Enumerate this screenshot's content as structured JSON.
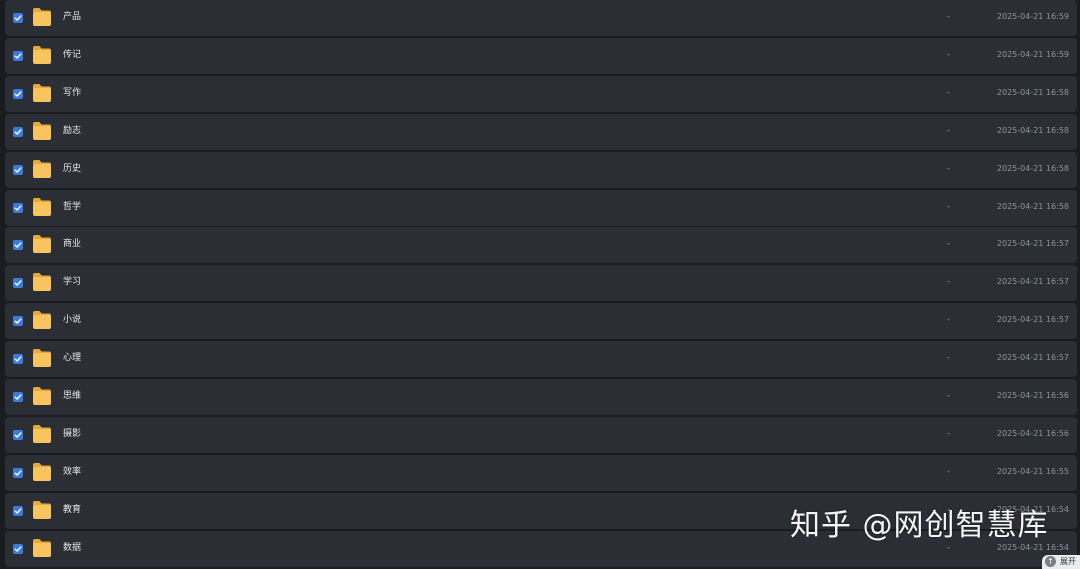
{
  "rows": [
    {
      "name": "产品",
      "size": "-",
      "date": "2025-04-21 16:59",
      "checked": true
    },
    {
      "name": "传记",
      "size": "-",
      "date": "2025-04-21 16:59",
      "checked": true
    },
    {
      "name": "写作",
      "size": "-",
      "date": "2025-04-21 16:58",
      "checked": true
    },
    {
      "name": "励志",
      "size": "-",
      "date": "2025-04-21 16:58",
      "checked": true
    },
    {
      "name": "历史",
      "size": "-",
      "date": "2025-04-21 16:58",
      "checked": true
    },
    {
      "name": "哲学",
      "size": "-",
      "date": "2025-04-21 16:58",
      "checked": true
    },
    {
      "name": "商业",
      "size": "-",
      "date": "2025-04-21 16:57",
      "checked": true
    },
    {
      "name": "学习",
      "size": "-",
      "date": "2025-04-21 16:57",
      "checked": true
    },
    {
      "name": "小说",
      "size": "-",
      "date": "2025-04-21 16:57",
      "checked": true
    },
    {
      "name": "心理",
      "size": "-",
      "date": "2025-04-21 16:57",
      "checked": true
    },
    {
      "name": "思维",
      "size": "-",
      "date": "2025-04-21 16:56",
      "checked": true
    },
    {
      "name": "摄影",
      "size": "-",
      "date": "2025-04-21 16:56",
      "checked": true
    },
    {
      "name": "效率",
      "size": "-",
      "date": "2025-04-21 16:55",
      "checked": true
    },
    {
      "name": "教育",
      "size": "-",
      "date": "2025-04-21 16:54",
      "checked": true
    },
    {
      "name": "数据",
      "size": "-",
      "date": "2025-04-21 16:54",
      "checked": true
    }
  ],
  "icons": {
    "checkbox": "checkbox-checked-icon",
    "folder": "folder-icon",
    "expand": "arrow-up-icon"
  },
  "colors": {
    "background": "#1a1c20",
    "row": "#2b2e35",
    "checkbox": "#3b7be0",
    "folder": "#f7c45e",
    "text": "#e6e8eb",
    "muted": "#8f939a"
  },
  "watermark": "知乎 @网创智慧库",
  "expand_button": {
    "label": "展开"
  }
}
